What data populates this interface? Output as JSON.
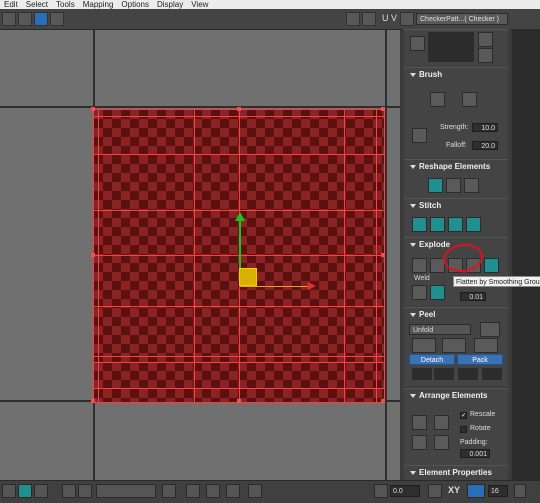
{
  "menu": [
    "Edit",
    "Select",
    "Tools",
    "Mapping",
    "Options",
    "Display",
    "View"
  ],
  "toolbar": {
    "uv_label": "U V",
    "texture_select": "CheckerPatt...( Checker )"
  },
  "brush": {
    "title": "Brush",
    "strength_label": "Strength:",
    "strength": "10.0",
    "falloff_label": "Falloff:",
    "falloff": "20.0"
  },
  "reshape": {
    "title": "Reshape Elements"
  },
  "stitch": {
    "title": "Stitch"
  },
  "explode": {
    "title": "Explode",
    "weld_label": "Weld",
    "weld_value": "0.01",
    "tooltip": "Flatten by Smoothing Groups"
  },
  "peel": {
    "title": "Peel",
    "unfold_label": "Unfold",
    "detach_label": "Detach",
    "pack_label": "Pack"
  },
  "arrange": {
    "title": "Arrange Elements",
    "rescale_label": "Rescale",
    "rotate_label": "Rotate",
    "padding_label": "Padding:",
    "padding_value": "0.001"
  },
  "element_props": {
    "title": "Element Properties"
  },
  "bottom": {
    "rotation_value": "0.0",
    "xy_label": "XY",
    "grid_value": "16"
  }
}
